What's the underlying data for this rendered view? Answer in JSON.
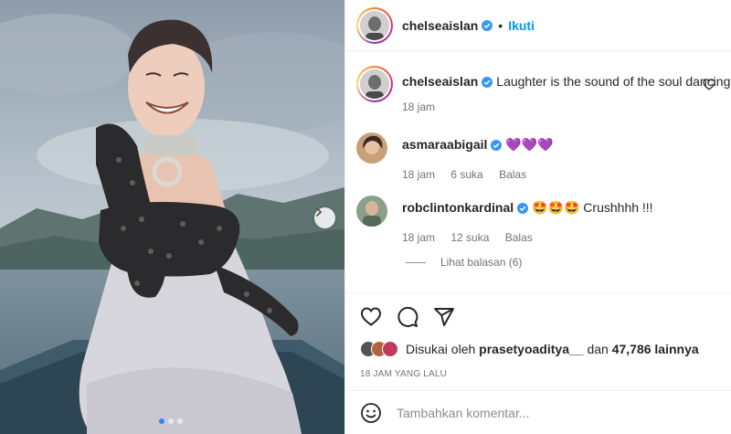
{
  "post": {
    "username": "chelseaislan",
    "separator": "•",
    "follow_label": "Ikuti"
  },
  "caption": {
    "username": "chelseaislan",
    "text": "Laughter is the sound of the soul dancing",
    "time": "18 jam"
  },
  "comments": [
    {
      "username": "asmaraabigail",
      "text": "💜💜💜",
      "time": "18 jam",
      "likes": "6 suka",
      "reply_label": "Balas"
    },
    {
      "username": "robclintonkardinal",
      "text": "🤩🤩🤩 Crushhhh !!!",
      "time": "18 jam",
      "likes": "12 suka",
      "reply_label": "Balas"
    }
  ],
  "view_replies": "Lihat balasan (6)",
  "likes": {
    "prefix": "Disukai oleh",
    "user": "prasetyoaditya__",
    "joiner": "dan",
    "count": "47,786 lainnya"
  },
  "time_ago": "18 JAM YANG LALU",
  "add_comment": {
    "placeholder": "Tambahkan komentar..."
  },
  "carousel": {
    "count": 3,
    "active_index": 0
  },
  "colors": {
    "link": "#0095f6",
    "verified": "#3897f0",
    "muted": "#737373"
  },
  "icons": [
    "chevron-right-icon",
    "heart-icon",
    "comment-icon",
    "share-icon",
    "emoji-icon",
    "verified-icon"
  ]
}
